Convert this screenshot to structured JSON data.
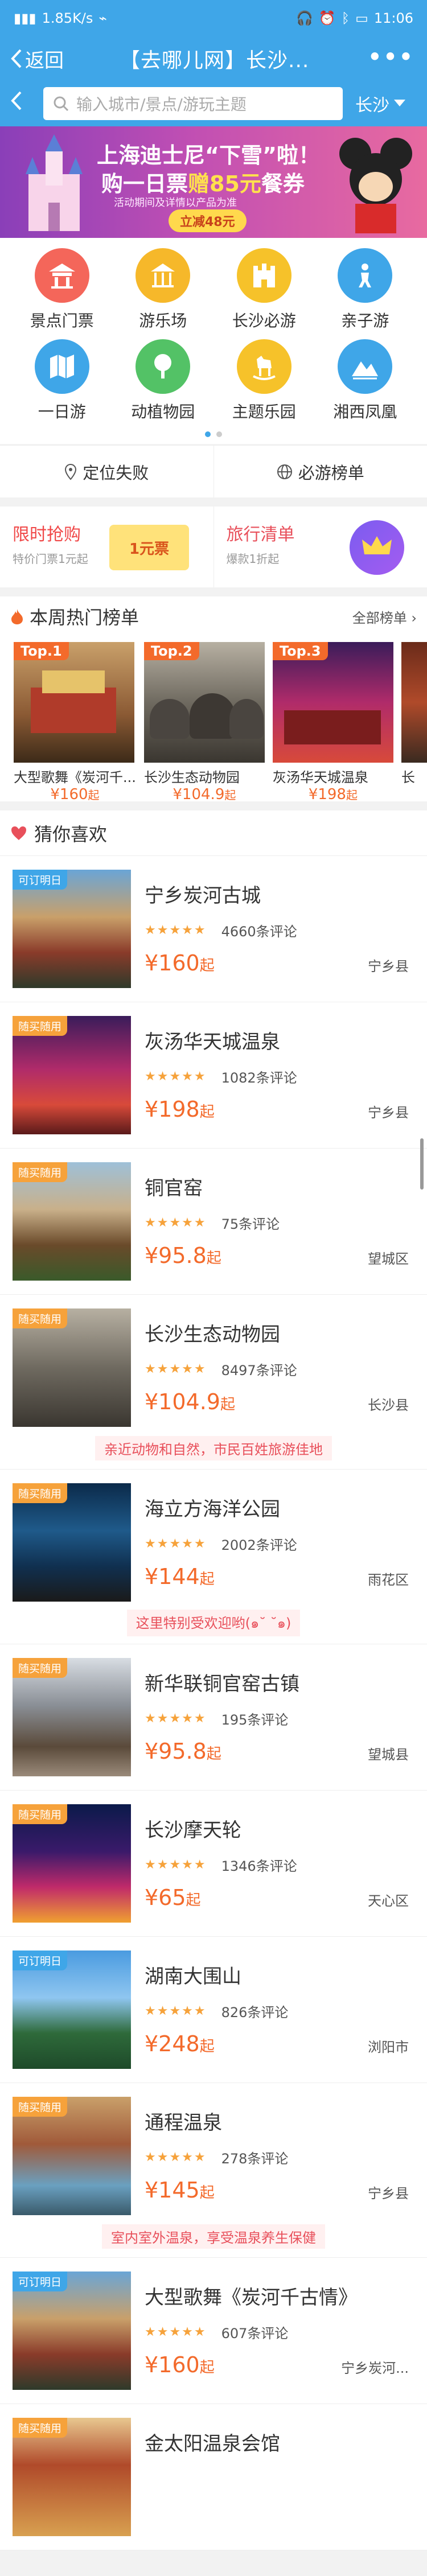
{
  "status": {
    "speed": "1.85K/s",
    "time": "11:06"
  },
  "header": {
    "back_label": "返回",
    "title": "【去哪儿网】长沙...",
    "more": "•••"
  },
  "search": {
    "placeholder": "输入城市/景点/游玩主题",
    "city": "长沙"
  },
  "banner": {
    "line1": "上海迪士尼“下雪”啦！",
    "line2_pre": "购一日票",
    "line2_hl": "赠85元",
    "line2_post": "餐券",
    "line3": "活动期间及详情以产品为准",
    "cta": "立减48元"
  },
  "categories": [
    {
      "label": "景点门票",
      "color": "#f4665a",
      "icon": "temple-icon"
    },
    {
      "label": "游乐场",
      "color": "#f6b82a",
      "icon": "carousel-icon"
    },
    {
      "label": "长沙必游",
      "color": "#f6c22a",
      "icon": "castle-icon"
    },
    {
      "label": "亲子游",
      "color": "#3fa6e8",
      "icon": "child-icon"
    },
    {
      "label": "一日游",
      "color": "#3fa6e8",
      "icon": "map-icon"
    },
    {
      "label": "动植物园",
      "color": "#53c266",
      "icon": "tree-icon"
    },
    {
      "label": "主题乐园",
      "color": "#f6c22a",
      "icon": "rocking-horse-icon"
    },
    {
      "label": "湘西凤凰",
      "color": "#3fa6e8",
      "icon": "mountain-icon"
    }
  ],
  "location": {
    "locate": "定位失败",
    "rank": "必游榜单"
  },
  "promo": {
    "left_title": "限时抢购",
    "left_sub": "特价门票1元起",
    "left_tag": "1元票",
    "right_title": "旅行清单",
    "right_sub": "爆款1折起"
  },
  "hot": {
    "title": "本周热门榜单",
    "all_label": "全部榜单",
    "items": [
      {
        "tag": "Top.1",
        "name": "大型歌舞《炭河千...",
        "price": "¥160",
        "unit": "起"
      },
      {
        "tag": "Top.2",
        "name": "长沙生态动物园",
        "price": "¥104.9",
        "unit": "起"
      },
      {
        "tag": "Top.3",
        "name": "灰汤华天城温泉",
        "price": "¥198",
        "unit": "起"
      },
      {
        "tag": "",
        "name": "长",
        "price": "",
        "unit": ""
      }
    ]
  },
  "like": {
    "title": "猜你喜欢",
    "items": [
      {
        "badge": "可订明日",
        "badge_color": "blue",
        "name": "宁乡炭河古城",
        "reviews": "4660条评论",
        "price": "¥160",
        "unit": "起",
        "area": "宁乡县",
        "note": ""
      },
      {
        "badge": "随买随用",
        "badge_color": "orange",
        "name": "灰汤华天城温泉",
        "reviews": "1082条评论",
        "price": "¥198",
        "unit": "起",
        "area": "宁乡县",
        "note": ""
      },
      {
        "badge": "随买随用",
        "badge_color": "orange",
        "name": "铜官窑",
        "reviews": "75条评论",
        "price": "¥95.8",
        "unit": "起",
        "area": "望城区",
        "note": ""
      },
      {
        "badge": "随买随用",
        "badge_color": "orange",
        "name": "长沙生态动物园",
        "reviews": "8497条评论",
        "price": "¥104.9",
        "unit": "起",
        "area": "长沙县",
        "note": "亲近动物和自然，市民百姓旅游佳地"
      },
      {
        "badge": "随买随用",
        "badge_color": "orange",
        "name": "海立方海洋公园",
        "reviews": "2002条评论",
        "price": "¥144",
        "unit": "起",
        "area": "雨花区",
        "note": "这里特别受欢迎哟(๑˘ ˘๑)"
      },
      {
        "badge": "随买随用",
        "badge_color": "orange",
        "name": "新华联铜官窑古镇",
        "reviews": "195条评论",
        "price": "¥95.8",
        "unit": "起",
        "area": "望城县",
        "note": ""
      },
      {
        "badge": "随买随用",
        "badge_color": "orange",
        "name": "长沙摩天轮",
        "reviews": "1346条评论",
        "price": "¥65",
        "unit": "起",
        "area": "天心区",
        "note": ""
      },
      {
        "badge": "可订明日",
        "badge_color": "blue",
        "name": "湖南大围山",
        "reviews": "826条评论",
        "price": "¥248",
        "unit": "起",
        "area": "浏阳市",
        "note": ""
      },
      {
        "badge": "随买随用",
        "badge_color": "orange",
        "name": "通程温泉",
        "reviews": "278条评论",
        "price": "¥145",
        "unit": "起",
        "area": "宁乡县",
        "note": "室内室外温泉，享受温泉养生保健"
      },
      {
        "badge": "可订明日",
        "badge_color": "blue",
        "name": "大型歌舞《炭河千古情》",
        "reviews": "607条评论",
        "price": "¥160",
        "unit": "起",
        "area": "宁乡炭河...",
        "note": ""
      },
      {
        "badge": "随买随用",
        "badge_color": "orange",
        "name": "金太阳温泉会馆",
        "reviews": "",
        "price": "",
        "unit": "",
        "area": "",
        "note": ""
      }
    ]
  }
}
